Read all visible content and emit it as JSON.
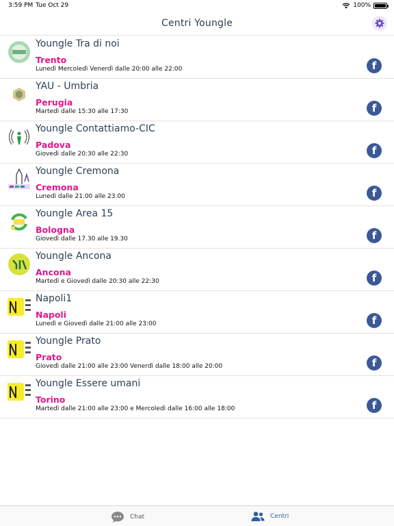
{
  "status": {
    "time": "3:59 PM",
    "date": "Tue Oct 29",
    "battery": "100%",
    "battery_level": 1.0
  },
  "header": {
    "title": "Centri Youngle"
  },
  "icons": {
    "settings": "gear-icon",
    "facebook": "facebook-icon",
    "chat": "chat-bubble-icon",
    "centri": "people-icon"
  },
  "colors": {
    "accent": "#e0188a",
    "title": "#2c4257",
    "facebook": "#3b5998",
    "tab_active": "#2c5ea8",
    "settings": "#6a4fc1"
  },
  "centers": [
    {
      "name": "Youngle Tra di noi",
      "city": "Trento",
      "schedule": "Lunedì Mercoledì Venerdì dalle 20:00 alle 22:00",
      "facebook": "f"
    },
    {
      "name": "YAU - Umbria",
      "city": "Perugia",
      "schedule": "Martedì dalle 15:30 alle 17:30",
      "facebook": "f"
    },
    {
      "name": "Youngle Contattiamo-CIC",
      "city": "Padova",
      "schedule": "Giovedì dalle 20:30 alle 22:30",
      "facebook": "f"
    },
    {
      "name": "Youngle Cremona",
      "city": "Cremona",
      "schedule": "Lunedì dalle 21.00 alle 23.00",
      "facebook": "f"
    },
    {
      "name": "Youngle Area 15",
      "city": "Bologna",
      "schedule": "Giovedì  dalle 17.30  alle 19.30",
      "facebook": "f"
    },
    {
      "name": "Youngle Ancona",
      "city": "Ancona",
      "schedule": "Martedì e Giovedì dalle 20:30 alle 22:30",
      "facebook": "f"
    },
    {
      "name": "Napoli1",
      "city": "Napoli",
      "schedule": "Lunedì e Giovedì dalle 21:00 alle 23:00",
      "facebook": "f"
    },
    {
      "name": "Youngle Prato",
      "city": "Prato",
      "schedule": "Giovedì dalle 21:00 alle 23:00 Venerdì dalle 18:00 alle 20:00",
      "facebook": "f"
    },
    {
      "name": "Youngle Essere umani",
      "city": "Torino",
      "schedule": "Martedì dalle 21:00 alle 23:00 e Mercoledì dalle 16:00 alle 18:00",
      "facebook": "f"
    }
  ],
  "tabs": [
    {
      "label": "Chat"
    },
    {
      "label": "Centri"
    }
  ]
}
